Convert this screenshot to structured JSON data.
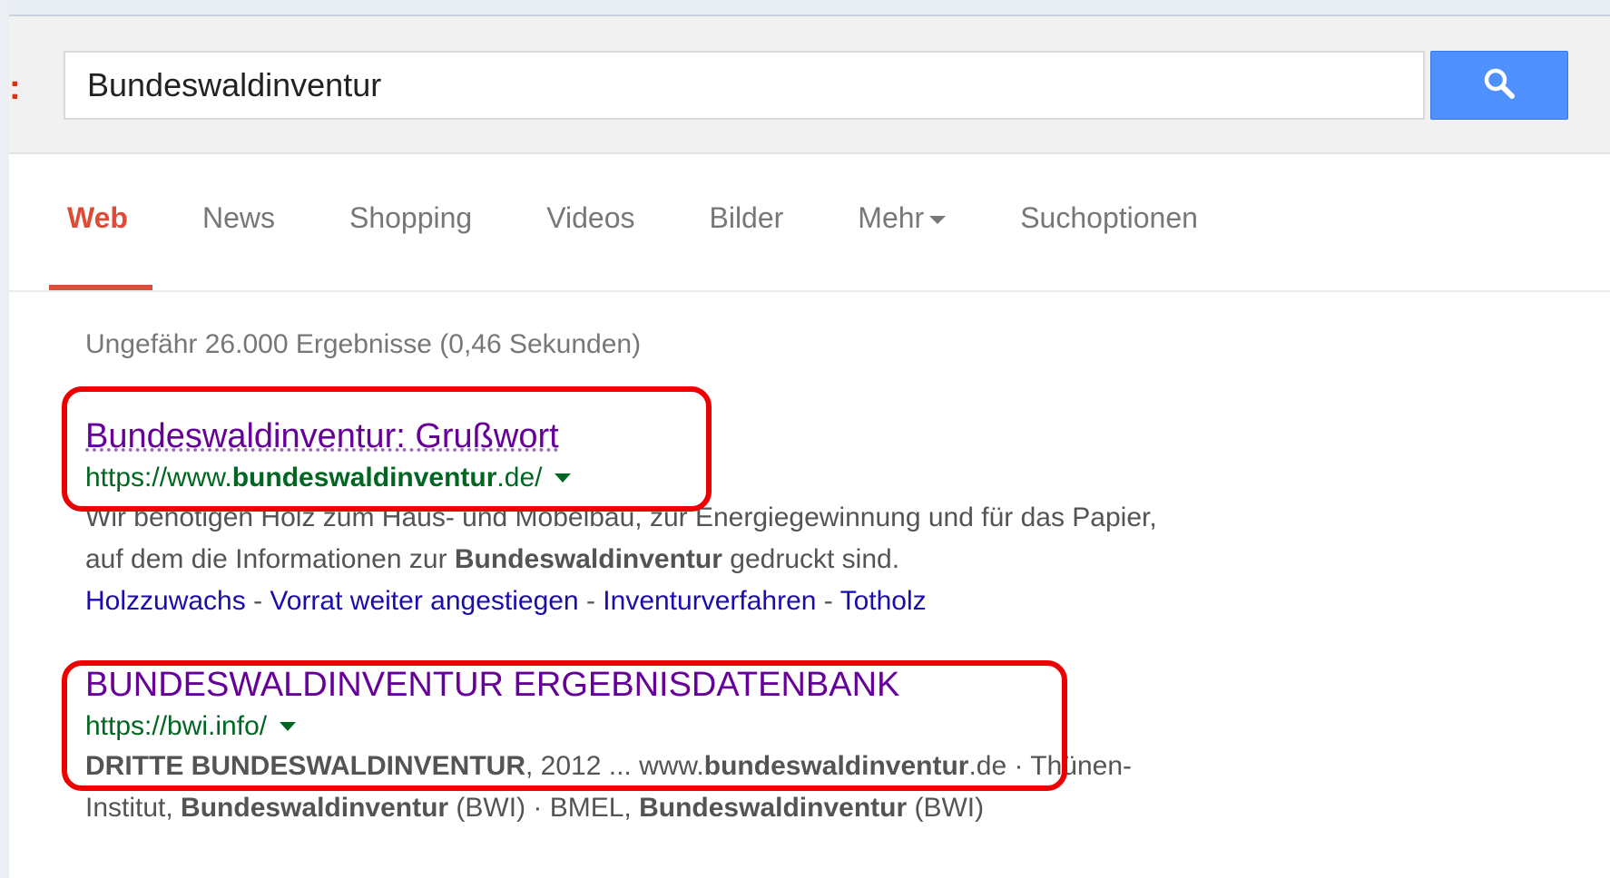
{
  "colors": {
    "accent_red": "#dd4b39",
    "search_button_blue": "#4d90fe",
    "visited_link": "#660099",
    "url_green": "#006621",
    "link_blue": "#1a0dab",
    "annotation_red": "#ee0000"
  },
  "search": {
    "query": "Bundeswaldinventur",
    "button_icon": "search-icon"
  },
  "tabs": [
    {
      "label": "Web",
      "active": true
    },
    {
      "label": "News"
    },
    {
      "label": "Shopping"
    },
    {
      "label": "Videos"
    },
    {
      "label": "Bilder"
    },
    {
      "label": "Mehr",
      "icon": "caret-down-icon"
    },
    {
      "label": "Suchoptionen"
    }
  ],
  "stats": "Ungefähr 26.000 Ergebnisse (0,46 Sekunden)",
  "results": [
    {
      "title": "Bundeswaldinventur: Grußwort",
      "url_prefix": "https://www.",
      "url_bold": "bundeswaldinventur",
      "url_suffix": ".de/",
      "snippet": {
        "line1": "Wir benötigen Holz zum Haus- und Möbelbau, zur Energiegewinnung und für das Papier,",
        "line2_pre": "auf dem die Informationen zur ",
        "line2_bold": "Bundeswaldinventur",
        "line2_post": " gedruckt sind."
      },
      "sitelinks": [
        "Holzzuwachs",
        "Vorrat weiter angestiegen",
        "Inventurverfahren",
        "Totholz"
      ],
      "sitelink_separator": " - "
    },
    {
      "title": "BUNDESWALDINVENTUR ERGEBNISDATENBANK",
      "url": "https://bwi.info/",
      "snippet": {
        "p1_bold": "DRITTE BUNDESWALDINVENTUR",
        "p2": ", 2012 ... www.",
        "p3_bold": "bundeswaldinventur",
        "p4": ".de · Thünen-",
        "p5": "Institut, ",
        "p6_bold": "Bundeswaldinventur",
        "p7": " (BWI) · BMEL, ",
        "p8_bold": "Bundeswaldinventur",
        "p9": " (BWI)"
      }
    }
  ]
}
